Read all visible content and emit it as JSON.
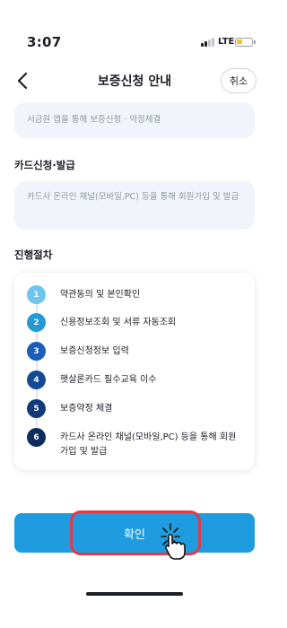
{
  "status_bar": {
    "time": "3:07",
    "network": "LTE"
  },
  "header": {
    "title": "보증신청 안내",
    "back_icon": "chevron-left-icon",
    "cancel_label": "취소"
  },
  "intro": {
    "text": "서금원 앱을 통해 보증신청 · 약정체결"
  },
  "card_section": {
    "title": "카드신청·발급",
    "text": "카드사 온라인 채널(모바일,PC) 등을 통해 회원가입 및 발급"
  },
  "procedure": {
    "title": "진행절차",
    "steps": [
      {
        "num": "1",
        "label": "약관동의 및 본인확인",
        "color": "#6cc6ee"
      },
      {
        "num": "2",
        "label": "신용정보조회 및 서류 자동조회",
        "color": "#229ad6"
      },
      {
        "num": "3",
        "label": "보증신청정보 입력",
        "color": "#1a5fb8"
      },
      {
        "num": "4",
        "label": "햇살론카드 필수교육 이수",
        "color": "#134a98"
      },
      {
        "num": "5",
        "label": "보증약정 체결",
        "color": "#103a7a"
      },
      {
        "num": "6",
        "label": "카드사 온라인 채널(모바일,PC) 등을 통해 회원가입 및 발급",
        "color": "#0c2c5e"
      }
    ]
  },
  "confirm": {
    "label": "확인"
  },
  "colors": {
    "accent": "#1f9ce0",
    "highlight": "#e53946",
    "box_bg": "#f1f5fb"
  },
  "icons": {
    "pointer": "hand-pointer-icon"
  }
}
